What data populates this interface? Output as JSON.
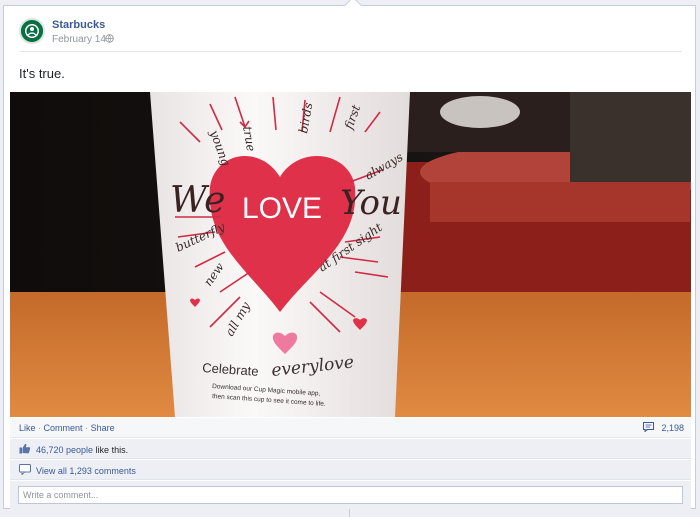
{
  "post": {
    "author": "Starbucks",
    "date": "February 14",
    "status_text": "It's true.",
    "photo": {
      "cup_text": {
        "we": "We",
        "love": "LOVE",
        "you": "You",
        "celebrate": "Celebrate",
        "everylove": "everylove",
        "download_line1": "Download our Cup Magic mobile app,",
        "download_line2": "then scan this cup to see it come to life.",
        "arrow_words": [
          "true",
          "birds",
          "first",
          "always",
          "butterfly",
          "new",
          "at first sight",
          "all my",
          "young"
        ]
      }
    }
  },
  "actions": {
    "like": "Like",
    "comment": "Comment",
    "share": "Share",
    "separator": "·",
    "comment_count": "2,198"
  },
  "likes": {
    "count": "46,720 people",
    "suffix": " like this."
  },
  "comments": {
    "view_all": "View all 1,293 comments"
  },
  "composer": {
    "placeholder": "Write a comment..."
  },
  "colors": {
    "link": "#3b5998",
    "heart": "#e0314b",
    "brand_green": "#0b6f45"
  },
  "icons": [
    "globe-icon",
    "comment-bubble-icon",
    "thumbs-up-icon",
    "speech-bubble-icon",
    "starbucks-logo"
  ]
}
